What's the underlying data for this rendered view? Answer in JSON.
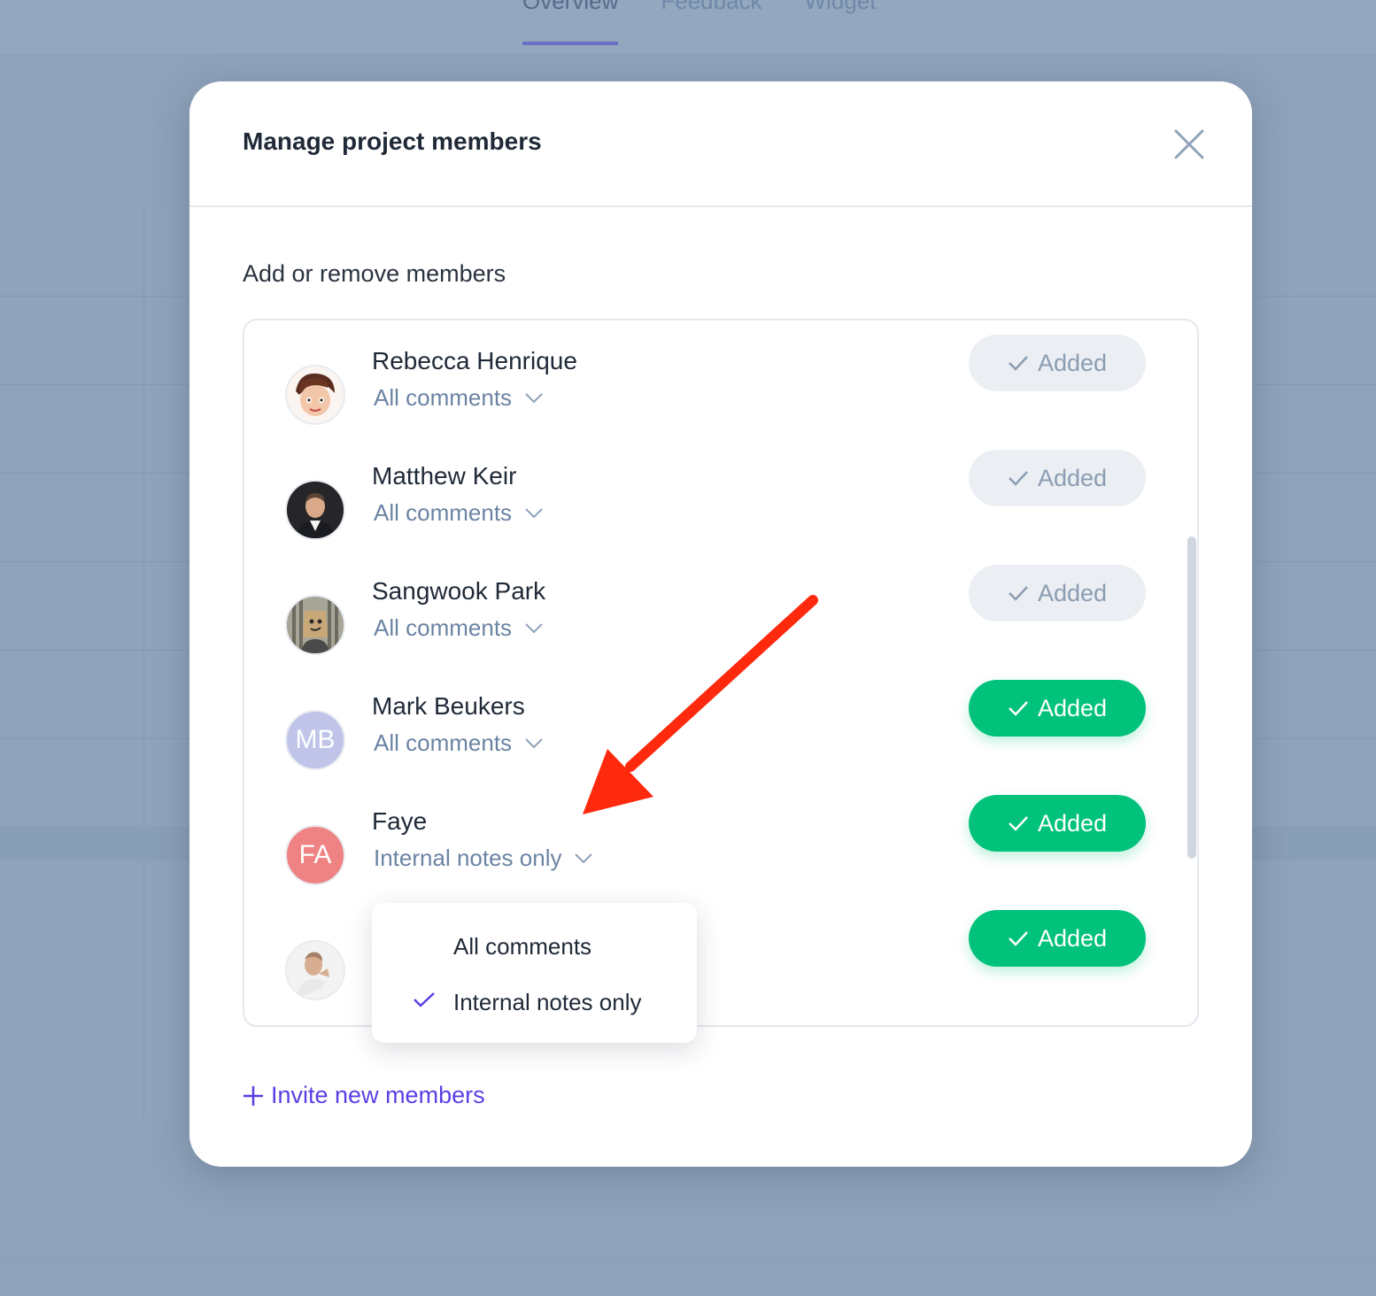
{
  "background": {
    "tabs": [
      "Overview",
      "Feedback",
      "Widget"
    ],
    "active_tab": "Overview"
  },
  "modal": {
    "title": "Manage project members",
    "section_label": "Add or remove members",
    "close_icon": "close-icon",
    "members": [
      {
        "name": "Rebecca Henrique",
        "permission": "All comments",
        "status": "Added",
        "state": "inactive",
        "avatar": "photo"
      },
      {
        "name": "Matthew Keir",
        "permission": "All comments",
        "status": "Added",
        "state": "inactive",
        "avatar": "photo"
      },
      {
        "name": "Sangwook Park",
        "permission": "All comments",
        "status": "Added",
        "state": "inactive",
        "avatar": "photo"
      },
      {
        "name": "Mark Beukers",
        "permission": "All comments",
        "status": "Added",
        "state": "active",
        "avatar": "initials",
        "initials": "MB",
        "avatar_color": "#c0c4e8"
      },
      {
        "name": "Faye",
        "permission": "Internal notes only",
        "status": "Added",
        "state": "active",
        "avatar": "initials",
        "initials": "FA",
        "avatar_color": "#ef8383"
      },
      {
        "name": "",
        "permission": "",
        "status": "Added",
        "state": "active",
        "avatar": "photo"
      }
    ],
    "dropdown": {
      "options": [
        "All comments",
        "Internal notes only"
      ],
      "selected": "Internal notes only"
    },
    "invite_label": "Invite new members"
  },
  "colors": {
    "accent": "#5b3fe4",
    "added_active": "#00c27a",
    "added_inactive": "#ebeef2",
    "annotation_arrow": "#ff2a0e"
  }
}
